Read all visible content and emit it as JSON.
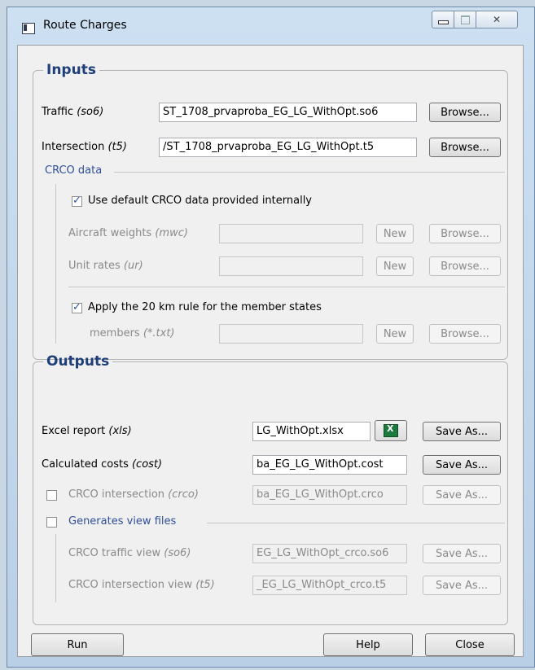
{
  "window": {
    "title": "Route Charges"
  },
  "inputs": {
    "legend": "Inputs",
    "traffic": {
      "label": "Traffic",
      "hint": "(so6)",
      "value": "ST_1708_prvaproba_EG_LG_WithOpt.so6",
      "browse": "Browse..."
    },
    "intersection": {
      "label": "Intersection",
      "hint": "(t5)",
      "value": "/ST_1708_prvaproba_EG_LG_WithOpt.t5",
      "browse": "Browse..."
    },
    "crco": {
      "legend": "CRCO data",
      "use_default_label": "Use default CRCO data provided internally",
      "use_default_checked": true,
      "aircraft": {
        "label": "Aircraft weights",
        "hint": "(mwc)",
        "value": "",
        "new": "New",
        "browse": "Browse..."
      },
      "unit_rates": {
        "label": "Unit rates",
        "hint": "(ur)",
        "value": "",
        "new": "New",
        "browse": "Browse..."
      },
      "rule_label": "Apply the 20 km rule for the member states",
      "rule_checked": true,
      "members": {
        "label": "members",
        "hint": "(*.txt)",
        "value": "",
        "new": "New",
        "browse": "Browse..."
      }
    }
  },
  "outputs": {
    "legend": "Outputs",
    "excel": {
      "label": "Excel report",
      "hint": "(xls)",
      "value": "LG_WithOpt.xlsx",
      "save": "Save As...",
      "icon": "excel-icon"
    },
    "costs": {
      "label": "Calculated costs",
      "hint": "(cost)",
      "value": "ba_EG_LG_WithOpt.cost",
      "save": "Save As..."
    },
    "crco_intersection": {
      "label": "CRCO intersection",
      "hint": "(crco)",
      "value": "ba_EG_LG_WithOpt.crco",
      "save": "Save As...",
      "checked": false
    },
    "views": {
      "legend": "Generates view files",
      "checked": false,
      "traffic_view": {
        "label": "CRCO traffic view",
        "hint": "(so6)",
        "value": "EG_LG_WithOpt_crco.so6",
        "save": "Save As..."
      },
      "intersection_view": {
        "label": "CRCO intersection view",
        "hint": "(t5)",
        "value": "_EG_LG_WithOpt_crco.t5",
        "save": "Save As..."
      }
    }
  },
  "footer": {
    "run": "Run",
    "help": "Help",
    "close": "Close"
  }
}
